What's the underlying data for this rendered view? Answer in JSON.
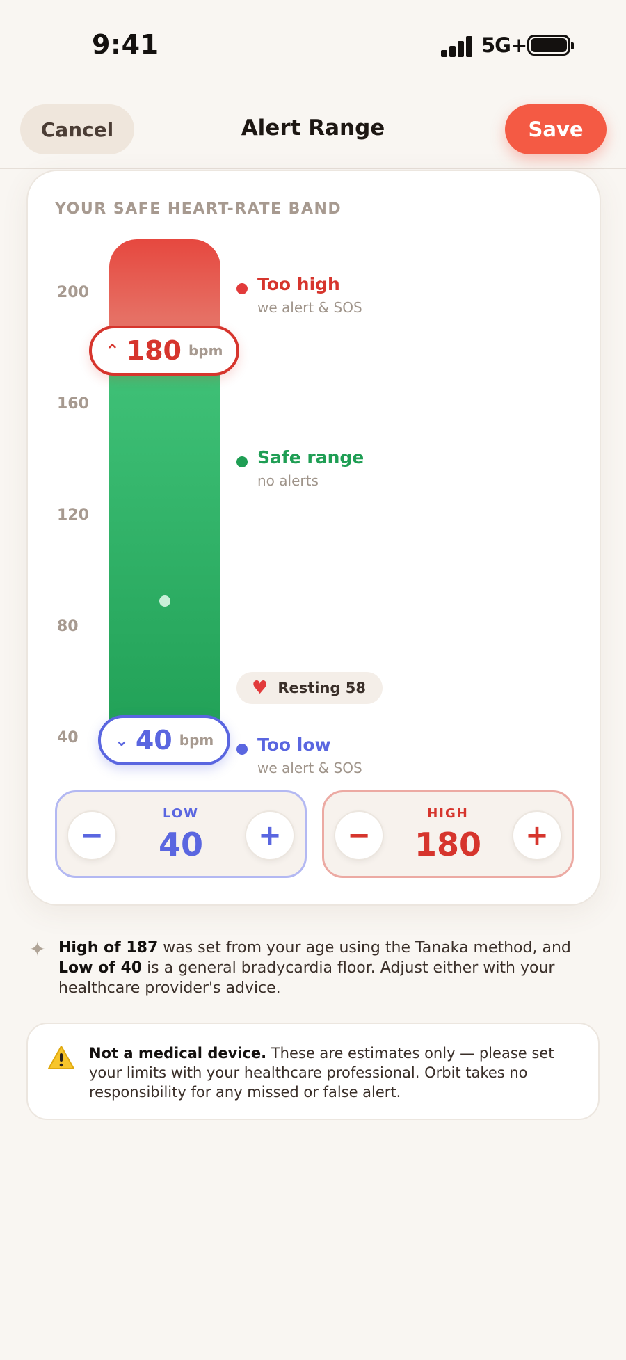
{
  "status_bar": {
    "time": "9:41",
    "network": "5G+"
  },
  "nav": {
    "cancel_label": "Cancel",
    "title": "Alert Range",
    "save_label": "Save"
  },
  "card": {
    "title": "YOUR SAFE HEART-RATE BAND",
    "axis_ticks": [
      "200",
      "160",
      "120",
      "80",
      "40"
    ],
    "high_thumb": {
      "caret": "⌃",
      "value": "180",
      "unit": "bpm"
    },
    "low_thumb": {
      "caret": "⌄",
      "value": "40",
      "unit": "bpm"
    },
    "zones": {
      "too_high": {
        "title": "Too high",
        "subtitle": "we alert & SOS",
        "color": "#e23b3b"
      },
      "safe": {
        "title": "Safe range",
        "subtitle": "no alerts",
        "color": "#1f9e54"
      },
      "too_low": {
        "title": "Too low",
        "subtitle": "we alert & SOS",
        "color": "#5a66e0"
      }
    },
    "resting": {
      "icon": "heart-icon",
      "label": "Resting 58"
    }
  },
  "steppers": {
    "low": {
      "label": "LOW",
      "value": "40",
      "minus": "−",
      "plus": "+"
    },
    "high": {
      "label": "HIGH",
      "value": "180",
      "minus": "−",
      "plus": "+"
    }
  },
  "note": {
    "bold1": "High of 187",
    "text1": " was set from your age using the Tanaka method, and ",
    "bold2": "Low of 40",
    "text2": " is a general bradycardia floor. Adjust either with your healthcare provider's advice."
  },
  "disclaimer": {
    "bold": "Not a medical device.",
    "text": " These are estimates only — please set your limits with your healthcare professional. Orbit takes no responsibility for any missed or false alert."
  }
}
